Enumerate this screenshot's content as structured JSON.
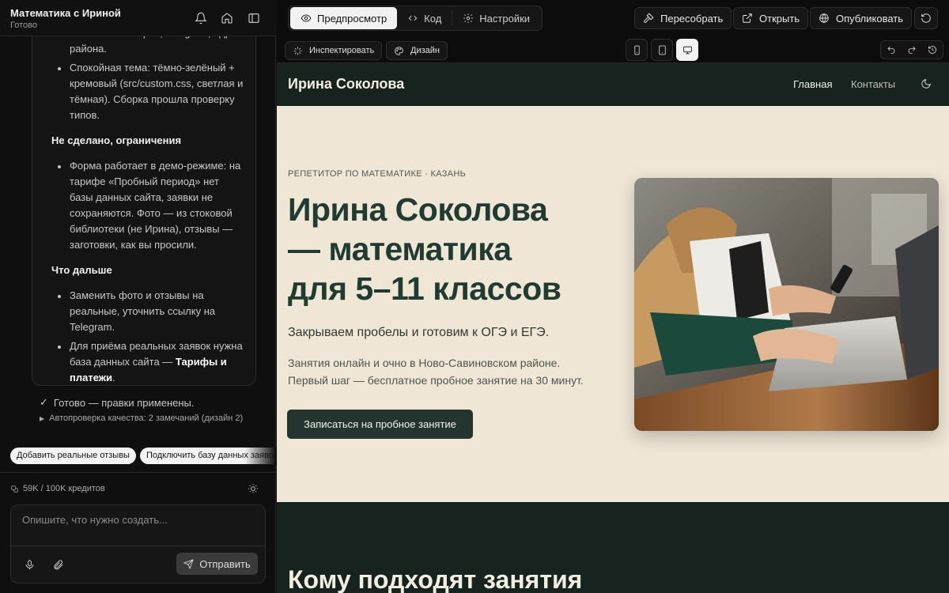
{
  "project": {
    "title": "Математика с Ириной",
    "status": "Готово"
  },
  "chat": {
    "top_fragment": "время, галочка согласия) + контакты: телефон, Telegram, адрес района.",
    "bullet_theme": "Спокойная тема: тёмно-зелёный + кремовый (src/custom.css, светлая и тёмная). Сборка прошла проверку типов.",
    "heading_not_done": "Не сделано, ограничения",
    "bullet_limits": "Форма работает в демо-режиме: на тарифе «Пробный период» нет базы данных сайта, заявки не сохраняются. Фото — из стоковой библиотеки (не Ирина), отзывы — заготовки, как вы просили.",
    "heading_next": "Что дальше",
    "bullet_next_1": "Заменить фото и отзывы на реальные, уточнить ссылку на Telegram.",
    "bullet_next_2_prefix": "Для приёма реальных заявок нужна база данных сайта — ",
    "bullet_next_2_link": "Тарифы и платежи",
    "bullet_next_2_suffix": ".",
    "done_line": "Готово — правки применены.",
    "autocheck": "Автопроверка качества: 2 замечаний (дизайн 2)"
  },
  "suggestions": [
    "Добавить реальные отзывы",
    "Подключить базу данных заявок"
  ],
  "credits": "59K / 100K кредитов",
  "composer": {
    "placeholder": "Опишите, что нужно создать...",
    "send_label": "Отправить"
  },
  "topbar": {
    "tabs": [
      {
        "label": "Предпросмотр",
        "icon": "eye-icon",
        "active": true
      },
      {
        "label": "Код",
        "icon": "code-icon",
        "active": false
      },
      {
        "label": "Настройки",
        "icon": "gear-icon",
        "active": false
      }
    ],
    "rebuild_label": "Пересобрать",
    "open_label": "Открыть",
    "publish_label": "Опубликовать"
  },
  "toolbar2": {
    "inspect_label": "Инспектировать",
    "design_label": "Дизайн",
    "devices": [
      "mobile",
      "tablet",
      "desktop"
    ],
    "active_device": "desktop"
  },
  "site": {
    "brand": "Ирина Соколова",
    "nav": [
      "Главная",
      "Контакты"
    ],
    "eyebrow": "РЕПЕТИТОР ПО МАТЕМАТИКЕ · КАЗАНЬ",
    "title_line1": "Ирина Соколова",
    "title_line2": "— математика",
    "title_line3": "для 5–11 классов",
    "subtitle": "Закрываем пробелы и готовим к ОГЭ и ЕГЭ.",
    "text_line1": "Занятия онлайн и очно в Ново-Савиновском районе.",
    "text_line2": "Первый шаг — бесплатное пробное занятие на 30 минут.",
    "cta": "Записаться на пробное занятие",
    "section_title": "Кому подходят занятия"
  },
  "colors": {
    "site_dark": "#17231f",
    "site_cream": "#efe6d6",
    "site_heading": "#1f3b32",
    "cta_bg": "#243530"
  }
}
